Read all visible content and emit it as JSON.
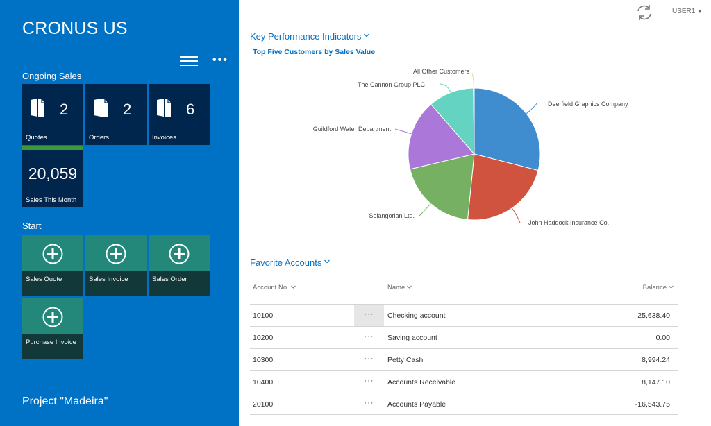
{
  "sidebar": {
    "company": "CRONUS US",
    "menu_icon": "hamburger-icon",
    "more_icon": "more-ellipsis-icon",
    "more_label": "•••",
    "ongoing_sales": {
      "title": "Ongoing Sales",
      "cues": [
        {
          "label": "Quotes",
          "count": "2",
          "icon": "document-icon"
        },
        {
          "label": "Orders",
          "count": "2",
          "icon": "document-icon"
        },
        {
          "label": "Invoices",
          "count": "6",
          "icon": "document-icon"
        }
      ],
      "kpi": {
        "label": "Sales This Month",
        "value": "20,059",
        "status_color": "#3a9a3a"
      }
    },
    "start": {
      "title": "Start",
      "actions": [
        {
          "label": "Sales Quote",
          "icon": "plus-circle-icon"
        },
        {
          "label": "Sales Invoice",
          "icon": "plus-circle-icon"
        },
        {
          "label": "Sales Order",
          "icon": "plus-circle-icon"
        },
        {
          "label": "Purchase Invoice",
          "icon": "plus-circle-icon"
        }
      ]
    },
    "footer": "Project \"Madeira\""
  },
  "topbar": {
    "sync_icon": "refresh-icon",
    "user": "USER1",
    "user_caret": "▼"
  },
  "kpi_section": {
    "title": "Key Performance Indicators",
    "chart_title": "Top Five Customers by Sales Value"
  },
  "chart_data": {
    "type": "pie",
    "title": "Top Five Customers by Sales Value",
    "start_angle": "top, clockwise",
    "slices": [
      {
        "label": "Deerfield Graphics Company",
        "value": 29.0,
        "color": "#3f8ccf"
      },
      {
        "label": "John Haddock Insurance Co.",
        "value": 22.6,
        "color": "#d0533f"
      },
      {
        "label": "Selangorian Ltd.",
        "value": 19.7,
        "color": "#76b163"
      },
      {
        "label": "Guildford Water Department",
        "value": 17.3,
        "color": "#ab78d9"
      },
      {
        "label": "The Cannon Group PLC",
        "value": 11.2,
        "color": "#64d3c1"
      },
      {
        "label": "All Other Customers",
        "value": 0.2,
        "color": "#f5d98a"
      }
    ],
    "unit": "percent of sales (estimated)"
  },
  "favorites": {
    "title": "Favorite Accounts",
    "columns": [
      {
        "label": "Account No."
      },
      {
        "label": "Name"
      },
      {
        "label": "Balance"
      }
    ],
    "row_menu_label": "···",
    "rows": [
      {
        "account_no": "10100",
        "name": "Checking account",
        "balance": "25,638.40"
      },
      {
        "account_no": "10200",
        "name": "Saving account",
        "balance": "0.00"
      },
      {
        "account_no": "10300",
        "name": "Petty Cash",
        "balance": "8,994.24"
      },
      {
        "account_no": "10400",
        "name": "Accounts Receivable",
        "balance": "8,147.10"
      },
      {
        "account_no": "20100",
        "name": "Accounts Payable",
        "balance": "-16,543.75"
      }
    ]
  }
}
